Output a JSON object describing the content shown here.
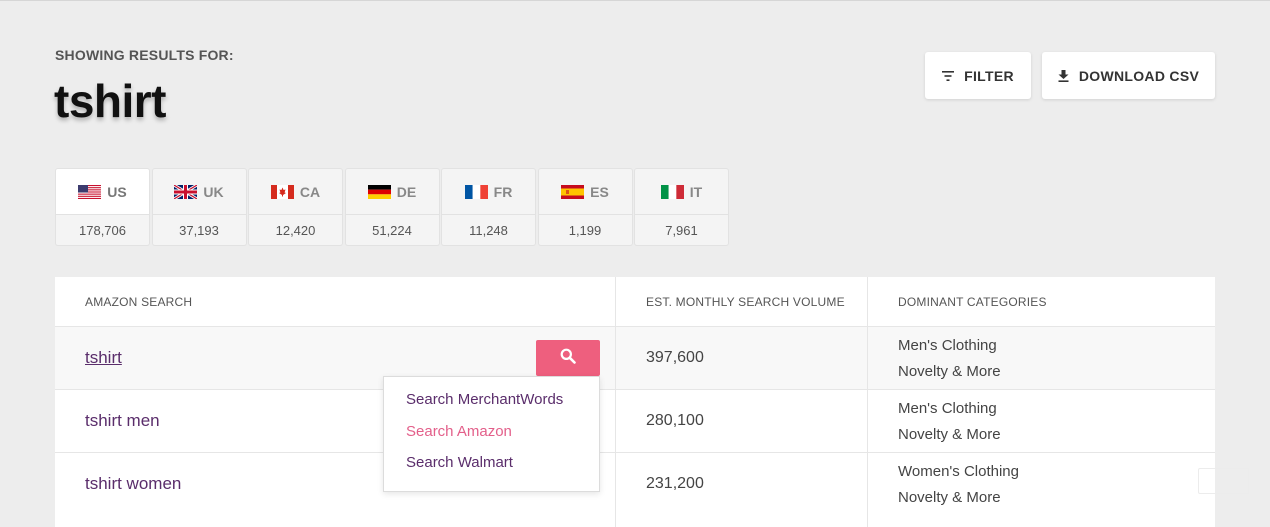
{
  "header": {
    "showing_label": "SHOWING RESULTS FOR:",
    "query": "tshirt"
  },
  "actions": {
    "filter_label": "FILTER",
    "download_label": "DOWNLOAD CSV"
  },
  "markets": [
    {
      "code": "US",
      "count": "178,706",
      "flag": "us-flag-icon"
    },
    {
      "code": "UK",
      "count": "37,193",
      "flag": "uk-flag-icon"
    },
    {
      "code": "CA",
      "count": "12,420",
      "flag": "ca-flag-icon"
    },
    {
      "code": "DE",
      "count": "51,224",
      "flag": "de-flag-icon"
    },
    {
      "code": "FR",
      "count": "11,248",
      "flag": "fr-flag-icon"
    },
    {
      "code": "ES",
      "count": "1,199",
      "flag": "es-flag-icon"
    },
    {
      "code": "IT",
      "count": "7,961",
      "flag": "it-flag-icon"
    }
  ],
  "table": {
    "columns": [
      "AMAZON SEARCH",
      "EST. MONTHLY SEARCH VOLUME",
      "DOMINANT CATEGORIES"
    ],
    "rows": [
      {
        "term": "tshirt",
        "volume": "397,600",
        "cat1": "Men's Clothing",
        "cat2": "Novelty & More"
      },
      {
        "term": "tshirt men",
        "volume": "280,100",
        "cat1": "Men's Clothing",
        "cat2": "Novelty & More"
      },
      {
        "term": "tshirt women",
        "volume": "231,200",
        "cat1": "Women's Clothing",
        "cat2": "Novelty & More"
      }
    ]
  },
  "dropdown": {
    "items": [
      "Search MerchantWords",
      "Search Amazon",
      "Search Walmart"
    ]
  },
  "colors": {
    "accent": "#ee5f7e",
    "link": "#5a2d6b",
    "background": "#ededed"
  }
}
